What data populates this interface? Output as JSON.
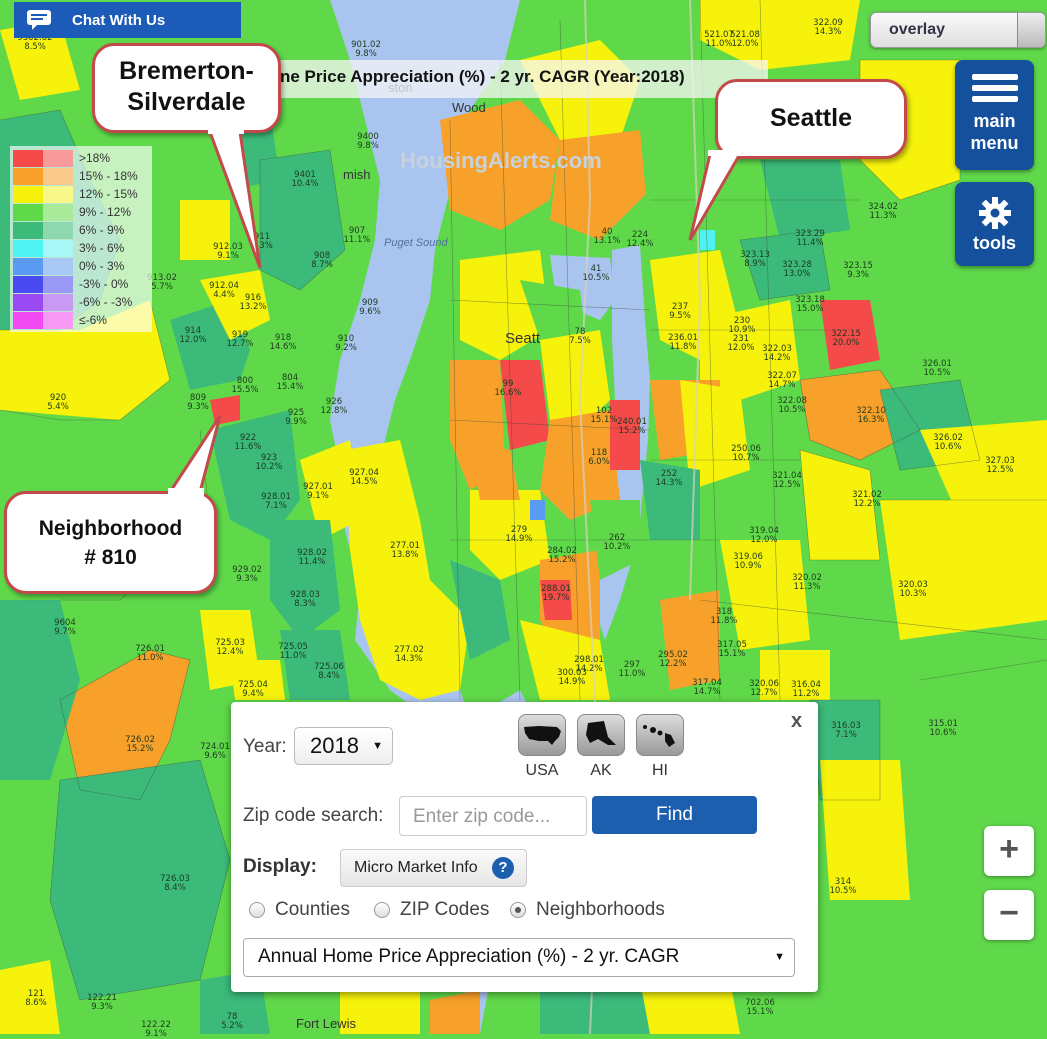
{
  "chat": {
    "label": "Chat With Us"
  },
  "overlay": {
    "label": "overlay"
  },
  "menu": {
    "main_label_1": "main",
    "main_label_2": "menu",
    "tools_label": "tools"
  },
  "title": "ne Price Appreciation (%) - 2 yr. CAGR (Year:2018)",
  "legend": [
    {
      "label": ">18%",
      "c1": "#f44a4a",
      "c2": "#f89a9a"
    },
    {
      "label": "15% - 18%",
      "c1": "#f7a02a",
      "c2": "#f9c98a"
    },
    {
      "label": "12% - 15%",
      "c1": "#f6f20c",
      "c2": "#f8f78a"
    },
    {
      "label": "9% - 12%",
      "c1": "#5fd94a",
      "c2": "#a8ea9a"
    },
    {
      "label": "6% - 9%",
      "c1": "#3cba7a",
      "c2": "#8ed8b0"
    },
    {
      "label": "3% - 6%",
      "c1": "#4ef2f2",
      "c2": "#a8f6f6"
    },
    {
      "label": "0% - 3%",
      "c1": "#5a9af2",
      "c2": "#a8c8f6"
    },
    {
      "label": "-3% - 0%",
      "c1": "#4a4af2",
      "c2": "#9a9af6"
    },
    {
      "label": "-6% - -3%",
      "c1": "#9a4af2",
      "c2": "#c89af6"
    },
    {
      "label": "≤-6%",
      "c1": "#f24af2",
      "c2": "#f69af6"
    }
  ],
  "callouts": {
    "bremerton_1": "Bremerton-",
    "bremerton_2": "Silverdale",
    "seattle": "Seattle",
    "nbhd_1": "Neighborhood",
    "nbhd_2": "# 810"
  },
  "map_text": {
    "watermark": "HousingAlerts.com",
    "puget_sound": "Puget Sound",
    "seattle": "Seatt",
    "fort_lewis": "Fort Lewis",
    "mish": "mish",
    "wood": "Wood",
    "ston": "ston"
  },
  "neighborhoods": [
    {
      "id": "9302.02",
      "v": "8.5%"
    },
    {
      "id": "901.02",
      "v": "9.8%"
    },
    {
      "id": "9400",
      "v": "9.8%"
    },
    {
      "id": "9401",
      "v": "10.4%"
    },
    {
      "id": "911",
      "v": "8.3%"
    },
    {
      "id": "907",
      "v": "11.1%"
    },
    {
      "id": "908",
      "v": "8.7%"
    },
    {
      "id": "912.03",
      "v": "9.1%"
    },
    {
      "id": "913.02",
      "v": "5.7%"
    },
    {
      "id": "912.04",
      "v": "4.4%"
    },
    {
      "id": "916",
      "v": "13.2%"
    },
    {
      "id": "909",
      "v": "9.6%"
    },
    {
      "id": "914",
      "v": "12.0%"
    },
    {
      "id": "919",
      "v": "12.7%"
    },
    {
      "id": "918",
      "v": "14.6%"
    },
    {
      "id": "910",
      "v": "9.2%"
    },
    {
      "id": "920",
      "v": "5.4%"
    },
    {
      "id": "809",
      "v": "9.3%"
    },
    {
      "id": "800",
      "v": "15.5%"
    },
    {
      "id": "804",
      "v": "15.4%"
    },
    {
      "id": "925",
      "v": "9.9%"
    },
    {
      "id": "926",
      "v": "12.8%"
    },
    {
      "id": "922",
      "v": "11.6%"
    },
    {
      "id": "923",
      "v": "10.2%"
    },
    {
      "id": "927.01",
      "v": "9.1%"
    },
    {
      "id": "927.04",
      "v": "14.5%"
    },
    {
      "id": "928.01",
      "v": "7.1%"
    },
    {
      "id": "928.02",
      "v": "11.4%"
    },
    {
      "id": "929.02",
      "v": "9.3%"
    },
    {
      "id": "928.03",
      "v": "8.3%"
    },
    {
      "id": "9604",
      "v": "9.7%"
    },
    {
      "id": "726.01",
      "v": "11.0%"
    },
    {
      "id": "725.03",
      "v": "12.4%"
    },
    {
      "id": "725.05",
      "v": "11.0%"
    },
    {
      "id": "725.06",
      "v": "8.4%"
    },
    {
      "id": "725.04",
      "v": "9.4%"
    },
    {
      "id": "726.02",
      "v": "15.2%"
    },
    {
      "id": "724.01",
      "v": "9.6%"
    },
    {
      "id": "726.03",
      "v": "8.4%"
    },
    {
      "id": "277.01",
      "v": "13.8%"
    },
    {
      "id": "277.02",
      "v": "14.3%"
    },
    {
      "id": "521.07",
      "v": "11.0%"
    },
    {
      "id": "521.08",
      "v": "12.0%"
    },
    {
      "id": "322.09",
      "v": "14.3%"
    },
    {
      "id": "324.02",
      "v": "11.3%"
    },
    {
      "id": "323.29",
      "v": "11.4%"
    },
    {
      "id": "323.13",
      "v": "8.9%"
    },
    {
      "id": "323.28",
      "v": "13.0%"
    },
    {
      "id": "323.15",
      "v": "9.3%"
    },
    {
      "id": "323.18",
      "v": "15.0%"
    },
    {
      "id": "322.15",
      "v": "20.0%"
    },
    {
      "id": "326.01",
      "v": "10.5%"
    },
    {
      "id": "322.10",
      "v": "16.3%"
    },
    {
      "id": "326.02",
      "v": "10.6%"
    },
    {
      "id": "327.03",
      "v": "12.5%"
    },
    {
      "id": "321.02",
      "v": "12.2%"
    },
    {
      "id": "321.04",
      "v": "12.5%"
    },
    {
      "id": "320.02",
      "v": "11.3%"
    },
    {
      "id": "320.03",
      "v": "10.3%"
    },
    {
      "id": "315.01",
      "v": "10.6%"
    },
    {
      "id": "316.03",
      "v": "7.1%"
    },
    {
      "id": "314",
      "v": "10.5%"
    },
    {
      "id": "319.04",
      "v": "12.0%"
    },
    {
      "id": "319.06",
      "v": "10.9%"
    },
    {
      "id": "250.06",
      "v": "10.7%"
    },
    {
      "id": "322.03",
      "v": "14.2%"
    },
    {
      "id": "322.07",
      "v": "14.7%"
    },
    {
      "id": "322.08",
      "v": "10.5%"
    },
    {
      "id": "262",
      "v": "10.2%"
    },
    {
      "id": "279",
      "v": "14.9%"
    },
    {
      "id": "284.02",
      "v": "15.2%"
    },
    {
      "id": "118",
      "v": "6.0%"
    },
    {
      "id": "102",
      "v": "15.1%"
    },
    {
      "id": "99",
      "v": "16.6%"
    },
    {
      "id": "78",
      "v": "7.5%"
    },
    {
      "id": "41",
      "v": "10.5%"
    },
    {
      "id": "40",
      "v": "13.1%"
    },
    {
      "id": "224",
      "v": "12.4%"
    },
    {
      "id": "237",
      "v": "9.5%"
    },
    {
      "id": "236.01",
      "v": "11.8%"
    },
    {
      "id": "252",
      "v": "14.3%"
    },
    {
      "id": "240.01",
      "v": "15.2%"
    },
    {
      "id": "297",
      "v": "11.0%"
    },
    {
      "id": "295.02",
      "v": "12.2%"
    },
    {
      "id": "317.04",
      "v": "14.7%"
    },
    {
      "id": "320.06",
      "v": "12.7%"
    },
    {
      "id": "316.04",
      "v": "11.2%"
    },
    {
      "id": "702.06",
      "v": "15.1%"
    },
    {
      "id": "122.21",
      "v": "9.3%"
    },
    {
      "id": "121",
      "v": "8.6%"
    },
    {
      "id": "78",
      "v": "5.2%"
    },
    {
      "id": "122.22",
      "v": "9.1%"
    },
    {
      "id": "230",
      "v": "10.9%"
    },
    {
      "id": "231",
      "v": "12.0%"
    },
    {
      "id": "317.05",
      "v": "15.1%"
    },
    {
      "id": "318",
      "v": "11.8%"
    },
    {
      "id": "298.01",
      "v": "14.2%"
    },
    {
      "id": "300.03",
      "v": "14.9%"
    },
    {
      "id": "288.01",
      "v": "19.7%"
    }
  ],
  "panel": {
    "close": "x",
    "year_label": "Year:",
    "year_value": "2018",
    "regions": [
      "USA",
      "AK",
      "HI"
    ],
    "zip_label": "Zip code search:",
    "zip_placeholder": "Enter zip code...",
    "find": "Find",
    "display_label": "Display:",
    "micro_label": "Micro Market Info",
    "micro_q": "?",
    "radios": [
      "Counties",
      "ZIP Codes",
      "Neighborhoods"
    ],
    "radio_selected": "Neighborhoods",
    "metric": "Annual Home Price Appreciation (%) - 2 yr. CAGR"
  },
  "zoom": {
    "in": "+",
    "out": "−"
  },
  "colors": {
    "water": "#a9c4ef",
    "brand_blue": "#14509c"
  }
}
